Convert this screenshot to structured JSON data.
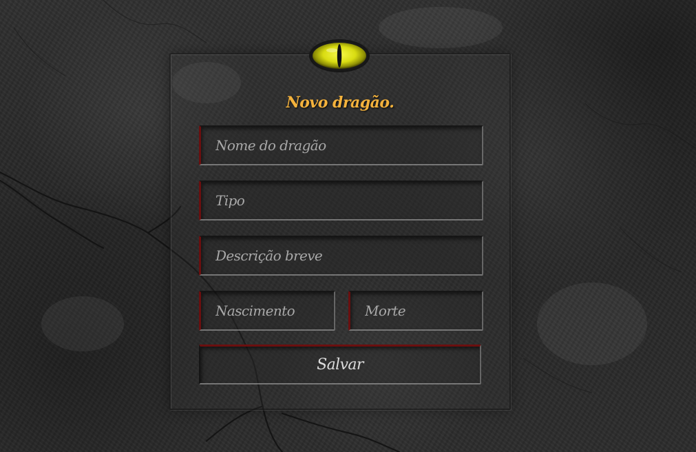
{
  "form": {
    "title": "Novo dragão.",
    "fields": {
      "name_placeholder": "Nome do dragão",
      "type_placeholder": "Tipo",
      "description_placeholder": "Descrição breve",
      "birth_placeholder": "Nascimento",
      "death_placeholder": "Morte"
    },
    "save_label": "Salvar"
  },
  "theme": {
    "accent": "#f4b23c",
    "field_edge": "#6b0f0f",
    "eye_color": "#e6e81a"
  },
  "icons": {
    "logo": "dragon-eye-icon"
  }
}
